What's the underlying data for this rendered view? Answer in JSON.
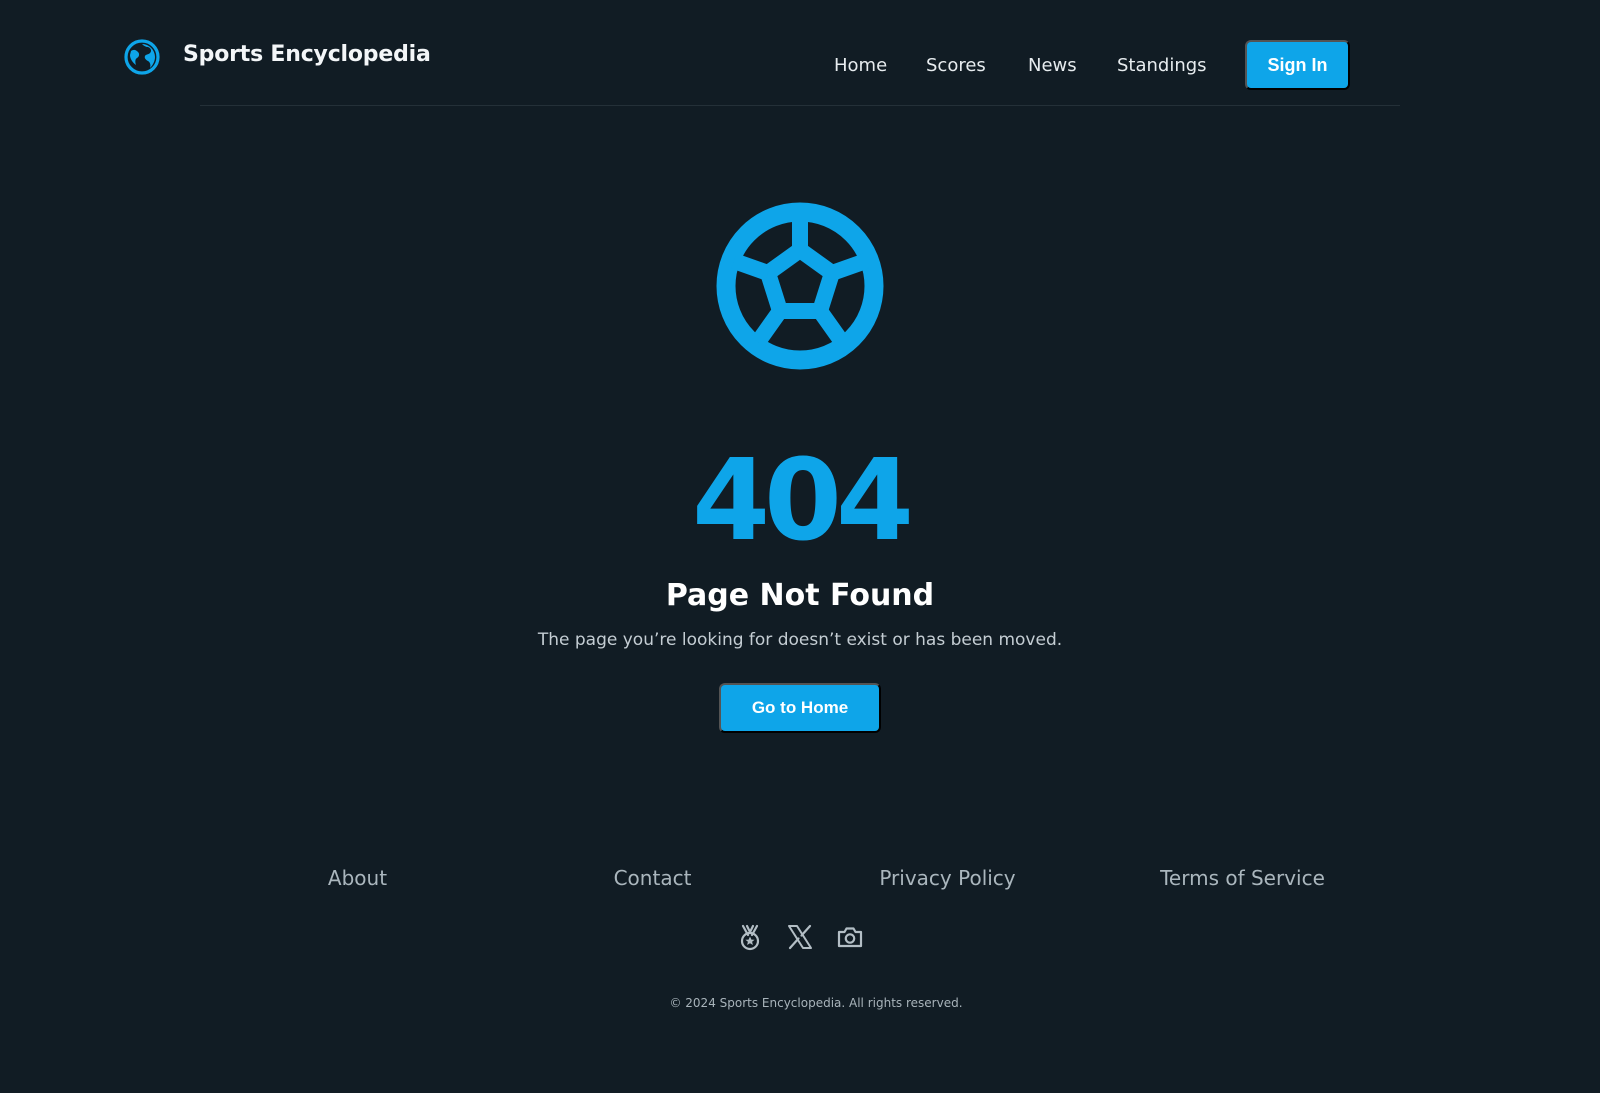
{
  "header": {
    "brand": "Sports Encyclopedia",
    "logo_icon": "globe-icon",
    "nav": [
      {
        "label": "Home"
      },
      {
        "label": "Scores"
      },
      {
        "label": "News"
      },
      {
        "label": "Standings"
      }
    ],
    "sign_in_label": "Sign In"
  },
  "main": {
    "illustration_icon": "soccer-ball-icon",
    "error_code": "404",
    "title": "Page Not Found",
    "description": "The page you’re looking for doesn’t exist or has been moved.",
    "home_button_label": "Go to Home"
  },
  "footer": {
    "links": [
      {
        "label": "About"
      },
      {
        "label": "Contact"
      },
      {
        "label": "Privacy Policy"
      },
      {
        "label": "Terms of Service"
      }
    ],
    "social_icons": [
      "medal-icon",
      "x-logo-icon",
      "camera-icon"
    ],
    "copyright": "© 2024 Sports Encyclopedia. All rights reserved."
  },
  "colors": {
    "background": "#111c24",
    "accent": "#0ea5e9",
    "text": "#ffffff",
    "muted_text": "#aab6bd"
  }
}
